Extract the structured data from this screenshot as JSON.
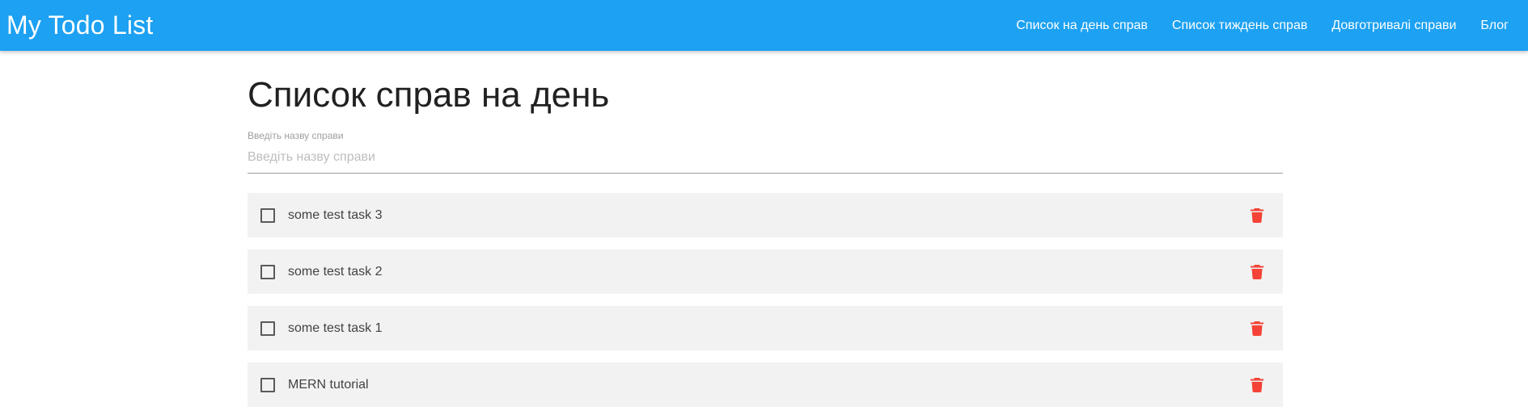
{
  "navbar": {
    "brand": "My Todo List",
    "links": [
      {
        "label": "Список на день справ"
      },
      {
        "label": "Список тиждень справ"
      },
      {
        "label": "Довготривалі справи"
      },
      {
        "label": "Блог"
      }
    ]
  },
  "main": {
    "title": "Список справ на день",
    "input": {
      "label": "Введіть назву справи",
      "placeholder": "Введіть назву справи",
      "value": ""
    },
    "tasks": [
      {
        "text": "some test task 3",
        "checked": false
      },
      {
        "text": "some test task 2",
        "checked": false
      },
      {
        "text": "some test task 1",
        "checked": false
      },
      {
        "text": "MERN tutorial",
        "checked": false
      }
    ]
  },
  "colors": {
    "navbar": "#1da1f2",
    "delete_icon": "#f44336",
    "task_bg": "#f2f2f2"
  },
  "icons": {
    "checkbox": "checkbox-unchecked-icon",
    "delete": "trash-icon"
  }
}
